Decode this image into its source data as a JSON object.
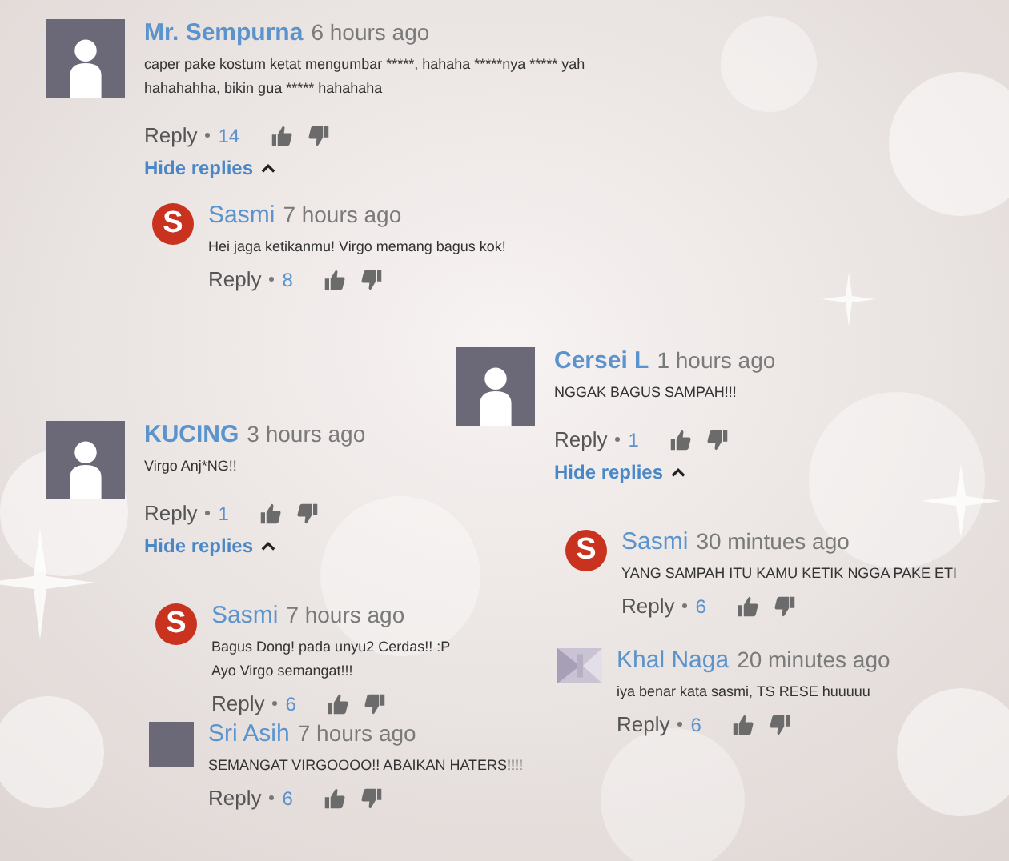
{
  "threads": [
    {
      "author": "Mr. Sempurna",
      "time": "6 hours ago",
      "avatar": {
        "kind": "placeholder"
      },
      "text": "caper pake kostum ketat mengumbar *****, hahaha *****nya ***** yah\nhahahahha, bikin gua ***** hahahaha",
      "reply_label": "Reply",
      "likes": "14",
      "hide_replies": "Hide replies",
      "replies": [
        {
          "author": "Sasmi",
          "time": "7 hours ago",
          "avatar": {
            "kind": "logo",
            "letter": "S"
          },
          "text": "Hei jaga ketikanmu! Virgo memang bagus kok!",
          "reply_label": "Reply",
          "likes": "8"
        }
      ]
    },
    {
      "author": "Cersei L",
      "time": "1 hours ago",
      "avatar": {
        "kind": "placeholder"
      },
      "text": "NGGAK BAGUS SAMPAH!!!",
      "reply_label": "Reply",
      "likes": "1",
      "hide_replies": "Hide replies",
      "replies": [
        {
          "author": "Sasmi",
          "time": "30 mintues ago",
          "avatar": {
            "kind": "logo",
            "letter": "S"
          },
          "text": "YANG SAMPAH ITU KAMU KETIK NGGA PAKE ETI",
          "reply_label": "Reply",
          "likes": "6"
        },
        {
          "author": "Khal Naga",
          "time": "20 minutes ago",
          "text": "iya benar kata sasmi, TS RESE huuuuu",
          "reply_label": "Reply",
          "likes": "6"
        }
      ]
    },
    {
      "author": "KUCING",
      "time": "3 hours ago",
      "avatar": {
        "kind": "placeholder"
      },
      "text": "Virgo Anj*NG!!",
      "reply_label": "Reply",
      "likes": "1",
      "hide_replies": "Hide replies",
      "replies": [
        {
          "author": "Sasmi",
          "time": "7 hours ago",
          "avatar": {
            "kind": "logo",
            "letter": "S"
          },
          "text": "Bagus Dong! pada unyu2 Cerdas!! :P\nAyo Virgo semangat!!!",
          "reply_label": "Reply",
          "likes": "6"
        },
        {
          "author": "Sri Asih",
          "time": "7 hours ago",
          "avatar": {
            "kind": "blank"
          },
          "text": "SEMANGAT VIRGOOOO!! ABAIKAN HATERS!!!!",
          "reply_label": "Reply",
          "likes": "6"
        }
      ]
    }
  ]
}
